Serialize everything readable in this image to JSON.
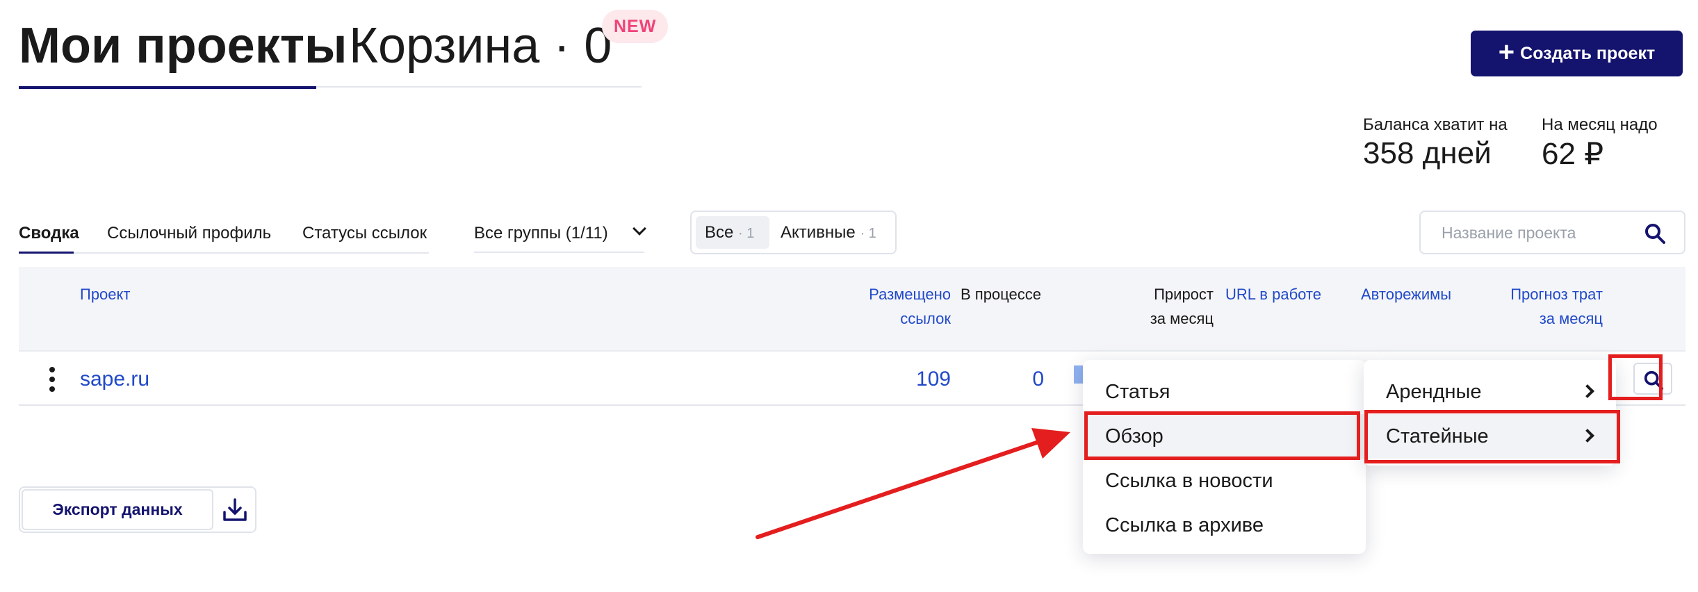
{
  "header": {
    "tabs": [
      {
        "label": "Мои проекты",
        "active": true
      },
      {
        "label": "Корзина · 0",
        "active": false
      }
    ],
    "new_badge": "NEW",
    "create_button": "Создать проект"
  },
  "balance": {
    "days_label": "Баланса хватит на",
    "days_value": "358 дней",
    "month_label": "На месяц надо",
    "month_value": "62 ₽"
  },
  "subtabs": {
    "items": [
      "Сводка",
      "Ссылочный профиль",
      "Статусы ссылок"
    ],
    "active_index": 0,
    "groups_label": "Все группы (1/11)"
  },
  "filter": {
    "all_label": "Все",
    "all_count": "· 1",
    "active_label": "Активные",
    "active_count": "· 1"
  },
  "search": {
    "placeholder": "Название проекта",
    "icon": "search-icon"
  },
  "table": {
    "headers": {
      "project": "Проект",
      "placed_1": "Размещено",
      "placed_2": "ссылок",
      "in_progress": "В процессе",
      "growth_1": "Прирост",
      "growth_2": "за месяц",
      "url": "URL в работе",
      "auto": "Авторежимы",
      "forecast_1": "Прогноз трат",
      "forecast_2": "за месяц"
    },
    "rows": [
      {
        "project": "sape.ru",
        "placed": "109",
        "in_progress": "0"
      }
    ]
  },
  "dropdown": {
    "items": [
      "Статья",
      "Обзор",
      "Ссылка в новости",
      "Ссылка в архиве"
    ],
    "highlighted_index": 1
  },
  "submenu": {
    "items": [
      "Арендные",
      "Статейные"
    ],
    "highlighted_index": 1
  },
  "export": {
    "label": "Экспорт данных"
  },
  "colors": {
    "brand": "#14136e",
    "link": "#2149c9",
    "annotation": "#e41e1e",
    "badge_text": "#f0437a"
  }
}
